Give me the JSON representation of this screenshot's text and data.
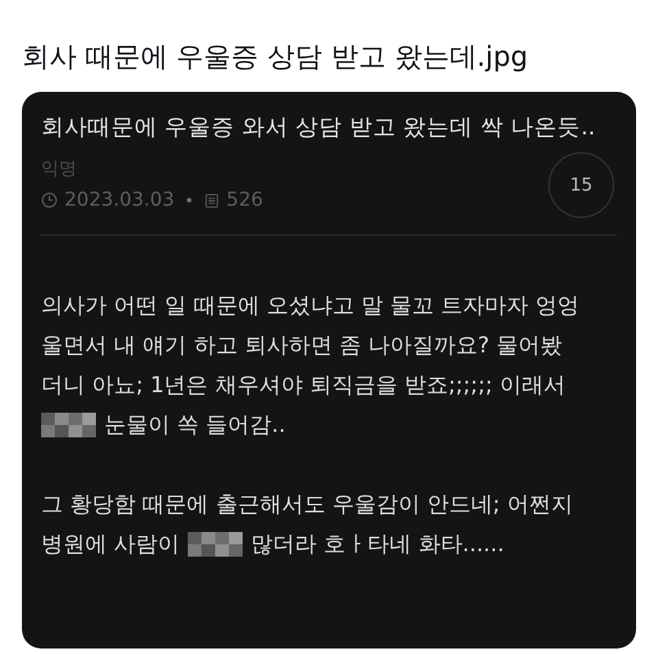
{
  "tweet_text": "회사 때문에 우울증 상담 받고 왔는데.jpg",
  "post": {
    "title": "회사때문에 우울증 와서 상담 받고 왔는데 싹 나온듯..",
    "author": "익명",
    "date": "2023.03.03",
    "views": "526",
    "comment_count": "15",
    "paragraphs": [
      [
        [
          {
            "kind": "text",
            "text": "의사가 어떤 일 때문에 오셨냐고 말 물꼬 트자마자 엉엉"
          }
        ],
        [
          {
            "kind": "text",
            "text": "울면서 내 얘기 하고 퇴사하면 좀 나아질까요? 물어봤"
          }
        ],
        [
          {
            "kind": "text",
            "text": "더니 아뇨; 1년은 채우셔야 퇴직금을 받죠;;;;;; 이래서"
          }
        ],
        [
          {
            "kind": "mosaic"
          },
          {
            "kind": "text",
            "text": "눈물이 쏙 들어감.."
          }
        ]
      ],
      [
        [
          {
            "kind": "text",
            "text": "그 황당함 때문에 출근해서도 우울감이 안드네; 어쩐지"
          }
        ],
        [
          {
            "kind": "text",
            "text": "병원에 사람이"
          },
          {
            "kind": "mosaic"
          },
          {
            "kind": "text",
            "text": "많더라 호ㅏ타네 화타......"
          }
        ]
      ]
    ]
  }
}
